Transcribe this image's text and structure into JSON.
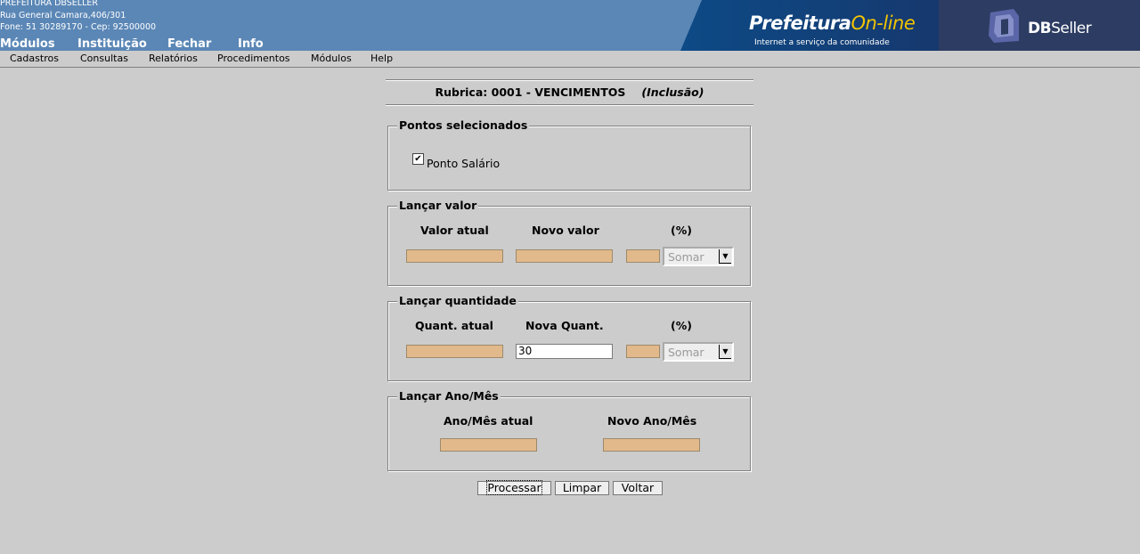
{
  "header": {
    "org_name": "PREFEITURA DBSELLER",
    "address": "Rua General Camara,406/301",
    "contact": "Fone: 51 30289170  -  Cep: 92500000",
    "menu": [
      "Módulos",
      "Instituição",
      "Fechar",
      "Info"
    ],
    "banner": {
      "brand_part1": "Prefeitura",
      "brand_part2": "On-line",
      "tagline": "Internet a serviço da comunidade",
      "vendor_bold": "DB",
      "vendor_rest": "Seller"
    }
  },
  "menubar": [
    "Cadastros",
    "Consultas",
    "Relatórios",
    "Procedimentos",
    "Módulos",
    "Help"
  ],
  "form": {
    "rubrica": "Rubrica: 0001 - VENCIMENTOS",
    "mode": "(Inclusão)",
    "pontos": {
      "legend": "Pontos selecionados",
      "checkbox_label": "Ponto Salário",
      "checked": true
    },
    "valor": {
      "legend": "Lançar valor",
      "col_atual": "Valor atual",
      "col_novo": "Novo valor",
      "col_pct": "(%)",
      "atual": "",
      "novo": "",
      "pct": "",
      "operation": "Somar"
    },
    "quantidade": {
      "legend": "Lançar quantidade",
      "col_atual": "Quant. atual",
      "col_novo": "Nova Quant.",
      "col_pct": "(%)",
      "atual": "",
      "novo": "30",
      "pct": "",
      "operation": "Somar"
    },
    "anomes": {
      "legend": "Lançar Ano/Mês",
      "col_atual": "Ano/Mês atual",
      "col_novo": "Novo Ano/Mês",
      "atual": "",
      "novo": ""
    }
  },
  "buttons": {
    "processar": "Processar",
    "limpar": "Limpar",
    "voltar": "Voltar"
  }
}
